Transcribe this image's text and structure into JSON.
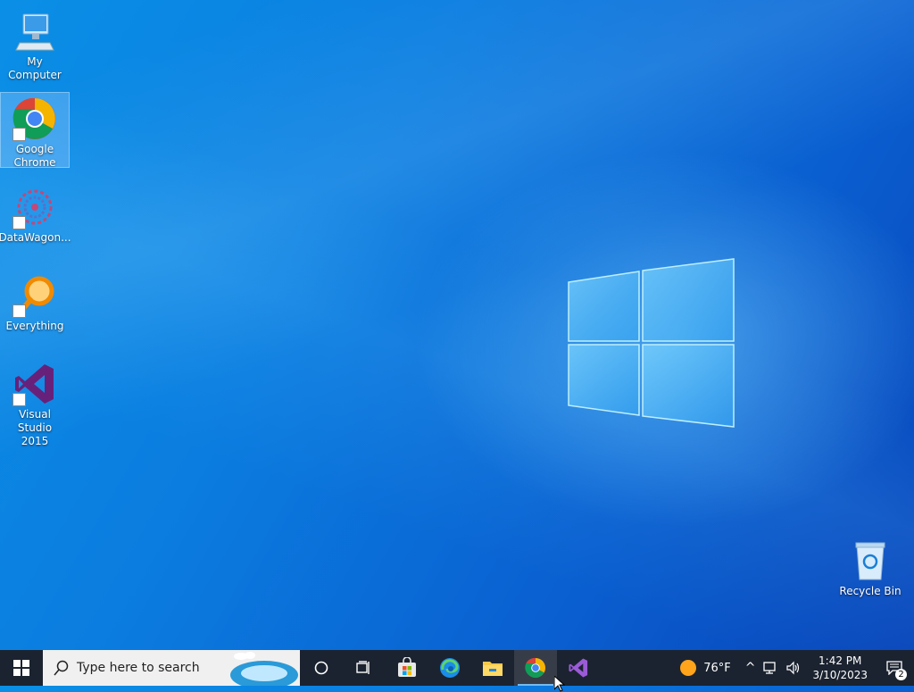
{
  "desktop": {
    "icons": [
      {
        "label": "My Computer",
        "icon": "computer-icon"
      },
      {
        "label": "Google Chrome",
        "icon": "chrome-icon"
      },
      {
        "label": "DataWagon...",
        "icon": "datawagon-icon"
      },
      {
        "label": "Everything",
        "icon": "everything-icon"
      },
      {
        "label": "Visual Studio 2015",
        "icon": "visual-studio-icon"
      },
      {
        "label": "Recycle Bin",
        "icon": "recycle-bin-icon"
      }
    ],
    "selected_icon": "Google Chrome"
  },
  "taskbar": {
    "search_placeholder": "Type here to search",
    "pinned": [
      "start",
      "cortana",
      "task-view",
      "microsoft-store",
      "edge",
      "file-explorer",
      "chrome",
      "visual-studio"
    ],
    "active_app": "chrome",
    "weather": {
      "temp": "76°F"
    },
    "clock": {
      "time": "1:42 PM",
      "date": "3/10/2023"
    },
    "notifications_count": "2"
  },
  "colors": {
    "accent": "#0078d7",
    "taskbar": "#1b2330"
  }
}
